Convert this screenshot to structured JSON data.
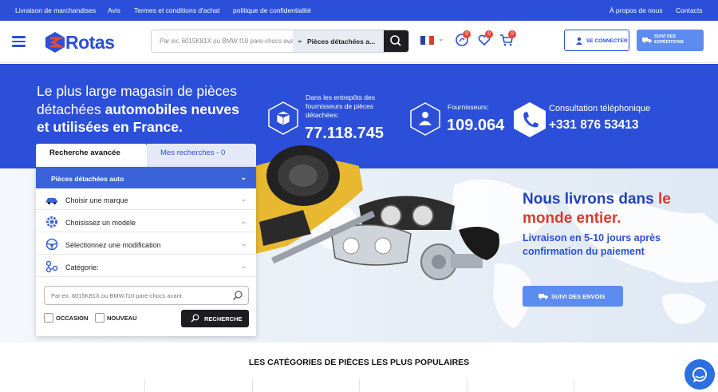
{
  "topbar": {
    "left_links": [
      "Livraison de marchandises",
      "Avis",
      "Termes et conditions d'achat",
      "politique de confidentialité"
    ],
    "right_links": [
      "À propos de nous",
      "Contacts"
    ]
  },
  "header": {
    "logo_text": "Rotas",
    "search_placeholder": "Par ex: 6015K81X ou BMW f10 pare-chocs avant",
    "search_category": "Pièces détachées a...",
    "badges": {
      "messages": "0",
      "favorites": "0",
      "cart": "0"
    },
    "login_label": "SE CONNECTER",
    "track_label_line1": "SUIVI DES",
    "track_label_line2": "EXPÉDITIONS"
  },
  "hero": {
    "tagline_plain_1": "Le plus large magasin de pièces détachées ",
    "tagline_bold_1": "automobiles neuves et utilisées en France.",
    "stats": [
      {
        "label": "Dans les entrepôts des fournisseurs de pièces détachées:",
        "value": "77.118.745"
      },
      {
        "label": "Fournisseurs:",
        "value": "109.064"
      },
      {
        "label": "Consultation téléphonique",
        "value": "+331 876 53413"
      }
    ]
  },
  "tabs": {
    "active": "Recherche avancée",
    "other": "Mes recherches - 0"
  },
  "filter": {
    "header": "Pièces détachées auto",
    "rows": [
      "Choisir une marque",
      "Choisissez un modèle",
      "Sélectionnez une modification",
      "Catégorie:"
    ],
    "search_placeholder": "Par ex: 6015K81X ou BMW f10 pare-chocs avant",
    "check_used": "OCCASION",
    "check_new": "NOUVEAU",
    "search_button": "RECHERCHE"
  },
  "promo": {
    "heading_part1": "Nous livrons dans ",
    "heading_red": "le monde entier.",
    "sub": "Livraison en 5-10 jours après confirmation du paiement",
    "button": "SUIVI DES ENVOIS"
  },
  "categories_title": "LES CATÉGORIES DE PIÈCES LES PLUS POPULAIRES",
  "colors": {
    "brand_blue": "#2b4fd8",
    "accent_light": "#5d8cf0",
    "red": "#d83b2c",
    "dark": "#1d1d22"
  }
}
